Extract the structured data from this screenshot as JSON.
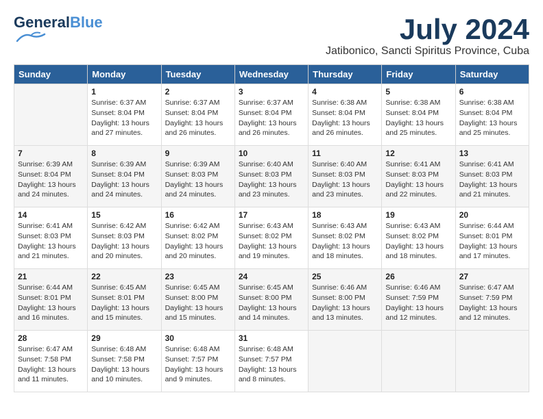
{
  "header": {
    "logo_text_normal": "General",
    "logo_text_accent": "Blue",
    "month_title": "July 2024",
    "location": "Jatibonico, Sancti Spiritus Province, Cuba"
  },
  "days_of_week": [
    "Sunday",
    "Monday",
    "Tuesday",
    "Wednesday",
    "Thursday",
    "Friday",
    "Saturday"
  ],
  "weeks": [
    [
      {
        "day": "",
        "info": ""
      },
      {
        "day": "1",
        "info": "Sunrise: 6:37 AM\nSunset: 8:04 PM\nDaylight: 13 hours\nand 27 minutes."
      },
      {
        "day": "2",
        "info": "Sunrise: 6:37 AM\nSunset: 8:04 PM\nDaylight: 13 hours\nand 26 minutes."
      },
      {
        "day": "3",
        "info": "Sunrise: 6:37 AM\nSunset: 8:04 PM\nDaylight: 13 hours\nand 26 minutes."
      },
      {
        "day": "4",
        "info": "Sunrise: 6:38 AM\nSunset: 8:04 PM\nDaylight: 13 hours\nand 26 minutes."
      },
      {
        "day": "5",
        "info": "Sunrise: 6:38 AM\nSunset: 8:04 PM\nDaylight: 13 hours\nand 25 minutes."
      },
      {
        "day": "6",
        "info": "Sunrise: 6:38 AM\nSunset: 8:04 PM\nDaylight: 13 hours\nand 25 minutes."
      }
    ],
    [
      {
        "day": "7",
        "info": "Sunrise: 6:39 AM\nSunset: 8:04 PM\nDaylight: 13 hours\nand 24 minutes."
      },
      {
        "day": "8",
        "info": "Sunrise: 6:39 AM\nSunset: 8:04 PM\nDaylight: 13 hours\nand 24 minutes."
      },
      {
        "day": "9",
        "info": "Sunrise: 6:39 AM\nSunset: 8:03 PM\nDaylight: 13 hours\nand 24 minutes."
      },
      {
        "day": "10",
        "info": "Sunrise: 6:40 AM\nSunset: 8:03 PM\nDaylight: 13 hours\nand 23 minutes."
      },
      {
        "day": "11",
        "info": "Sunrise: 6:40 AM\nSunset: 8:03 PM\nDaylight: 13 hours\nand 23 minutes."
      },
      {
        "day": "12",
        "info": "Sunrise: 6:41 AM\nSunset: 8:03 PM\nDaylight: 13 hours\nand 22 minutes."
      },
      {
        "day": "13",
        "info": "Sunrise: 6:41 AM\nSunset: 8:03 PM\nDaylight: 13 hours\nand 21 minutes."
      }
    ],
    [
      {
        "day": "14",
        "info": "Sunrise: 6:41 AM\nSunset: 8:03 PM\nDaylight: 13 hours\nand 21 minutes."
      },
      {
        "day": "15",
        "info": "Sunrise: 6:42 AM\nSunset: 8:03 PM\nDaylight: 13 hours\nand 20 minutes."
      },
      {
        "day": "16",
        "info": "Sunrise: 6:42 AM\nSunset: 8:02 PM\nDaylight: 13 hours\nand 20 minutes."
      },
      {
        "day": "17",
        "info": "Sunrise: 6:43 AM\nSunset: 8:02 PM\nDaylight: 13 hours\nand 19 minutes."
      },
      {
        "day": "18",
        "info": "Sunrise: 6:43 AM\nSunset: 8:02 PM\nDaylight: 13 hours\nand 18 minutes."
      },
      {
        "day": "19",
        "info": "Sunrise: 6:43 AM\nSunset: 8:02 PM\nDaylight: 13 hours\nand 18 minutes."
      },
      {
        "day": "20",
        "info": "Sunrise: 6:44 AM\nSunset: 8:01 PM\nDaylight: 13 hours\nand 17 minutes."
      }
    ],
    [
      {
        "day": "21",
        "info": "Sunrise: 6:44 AM\nSunset: 8:01 PM\nDaylight: 13 hours\nand 16 minutes."
      },
      {
        "day": "22",
        "info": "Sunrise: 6:45 AM\nSunset: 8:01 PM\nDaylight: 13 hours\nand 15 minutes."
      },
      {
        "day": "23",
        "info": "Sunrise: 6:45 AM\nSunset: 8:00 PM\nDaylight: 13 hours\nand 15 minutes."
      },
      {
        "day": "24",
        "info": "Sunrise: 6:45 AM\nSunset: 8:00 PM\nDaylight: 13 hours\nand 14 minutes."
      },
      {
        "day": "25",
        "info": "Sunrise: 6:46 AM\nSunset: 8:00 PM\nDaylight: 13 hours\nand 13 minutes."
      },
      {
        "day": "26",
        "info": "Sunrise: 6:46 AM\nSunset: 7:59 PM\nDaylight: 13 hours\nand 12 minutes."
      },
      {
        "day": "27",
        "info": "Sunrise: 6:47 AM\nSunset: 7:59 PM\nDaylight: 13 hours\nand 12 minutes."
      }
    ],
    [
      {
        "day": "28",
        "info": "Sunrise: 6:47 AM\nSunset: 7:58 PM\nDaylight: 13 hours\nand 11 minutes."
      },
      {
        "day": "29",
        "info": "Sunrise: 6:48 AM\nSunset: 7:58 PM\nDaylight: 13 hours\nand 10 minutes."
      },
      {
        "day": "30",
        "info": "Sunrise: 6:48 AM\nSunset: 7:57 PM\nDaylight: 13 hours\nand 9 minutes."
      },
      {
        "day": "31",
        "info": "Sunrise: 6:48 AM\nSunset: 7:57 PM\nDaylight: 13 hours\nand 8 minutes."
      },
      {
        "day": "",
        "info": ""
      },
      {
        "day": "",
        "info": ""
      },
      {
        "day": "",
        "info": ""
      }
    ]
  ]
}
